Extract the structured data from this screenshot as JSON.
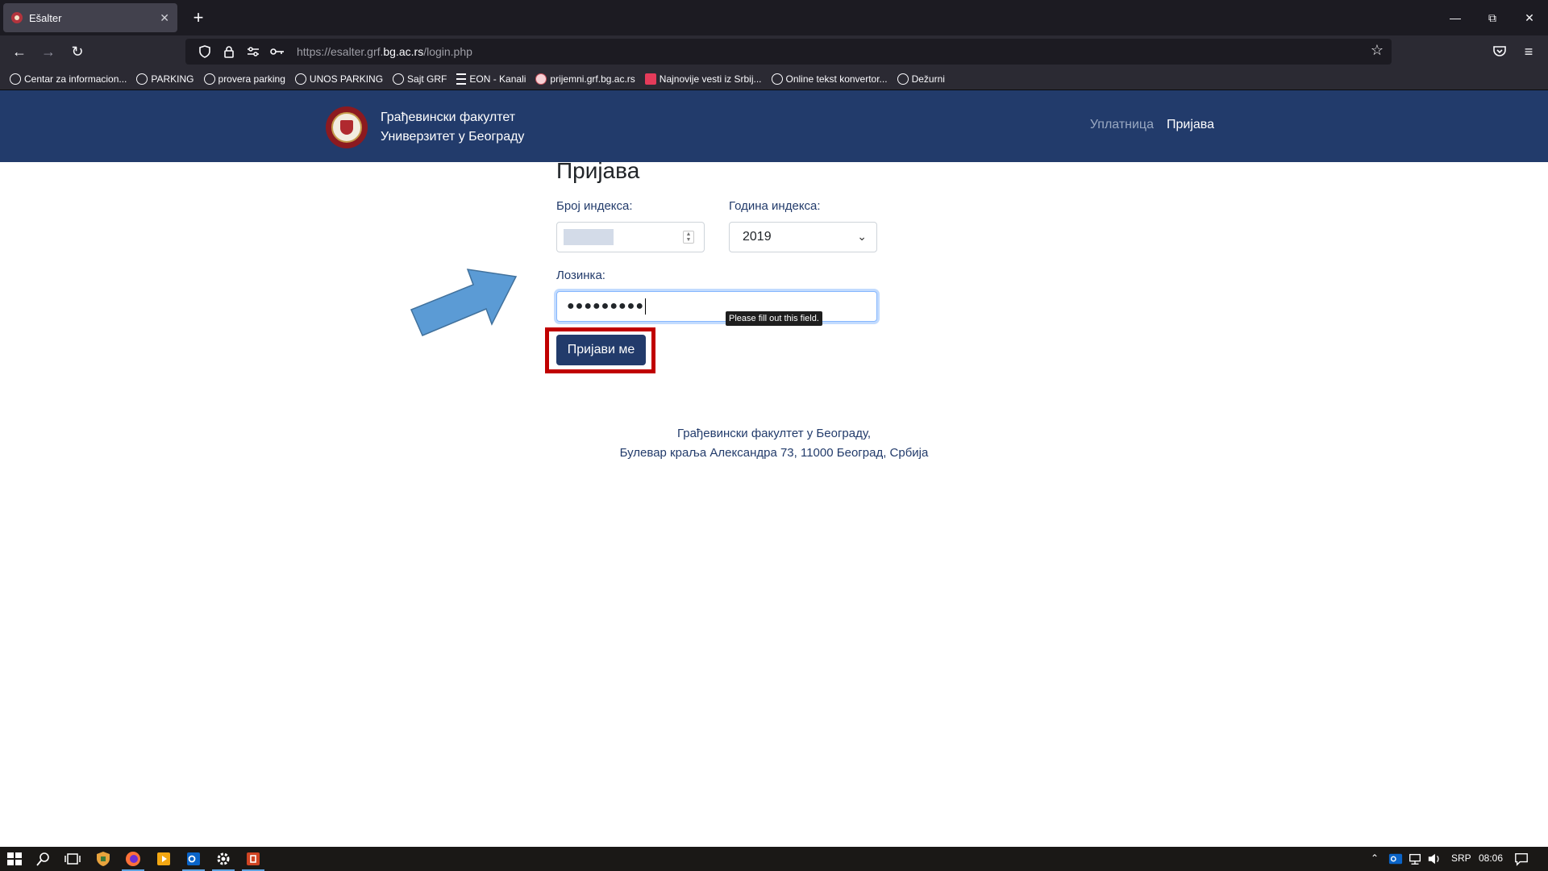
{
  "browser": {
    "tab_title": "Ešalter",
    "tab_close": "✕",
    "new_tab": "+",
    "url_prefix": "https://esalter.grf.",
    "url_domain": "bg.ac.rs",
    "url_path": "/login.php",
    "bookmarks": [
      {
        "label": "Centar za informacion...",
        "icon": "globe-icon"
      },
      {
        "label": "PARKING",
        "icon": "globe-icon"
      },
      {
        "label": "provera parking",
        "icon": "globe-icon"
      },
      {
        "label": "UNOS PARKING",
        "icon": "globe-icon"
      },
      {
        "label": "Sajt GRF",
        "icon": "globe-icon"
      },
      {
        "label": "EON - Kanali",
        "icon": "list-icon"
      },
      {
        "label": "prijemni.grf.bg.ac.rs",
        "icon": "site-icon"
      },
      {
        "label": "Najnovije vesti iz Srbij...",
        "icon": "news-icon"
      },
      {
        "label": "Online tekst konvertor...",
        "icon": "globe-icon"
      },
      {
        "label": "Dežurni",
        "icon": "globe-icon"
      }
    ]
  },
  "site": {
    "brand_line1": "Грађевински факултет",
    "brand_line2": "Универзитет у Београду",
    "nav_uplatnica": "Уплатница",
    "nav_prijava": "Пријава"
  },
  "form": {
    "title": "Пријава",
    "index_label": "Број индекса:",
    "year_label": "Година индекса:",
    "year_value": "2019",
    "password_label": "Лозинка:",
    "password_value": "●●●●●●●●●",
    "tooltip": "Please fill out this field.",
    "submit_label": "Пријави ме"
  },
  "footer": {
    "line1": "Грађевински факултет у Београду,",
    "line2": "Булевар краља Александра 73, 11000 Београд, Србија"
  },
  "taskbar": {
    "language": "SRP",
    "time": "08:06"
  },
  "colors": {
    "header_bg": "#223b6b",
    "button_bg": "#223b6b",
    "highlight": "#c00000",
    "arrow_fill": "#5b9bd5"
  }
}
